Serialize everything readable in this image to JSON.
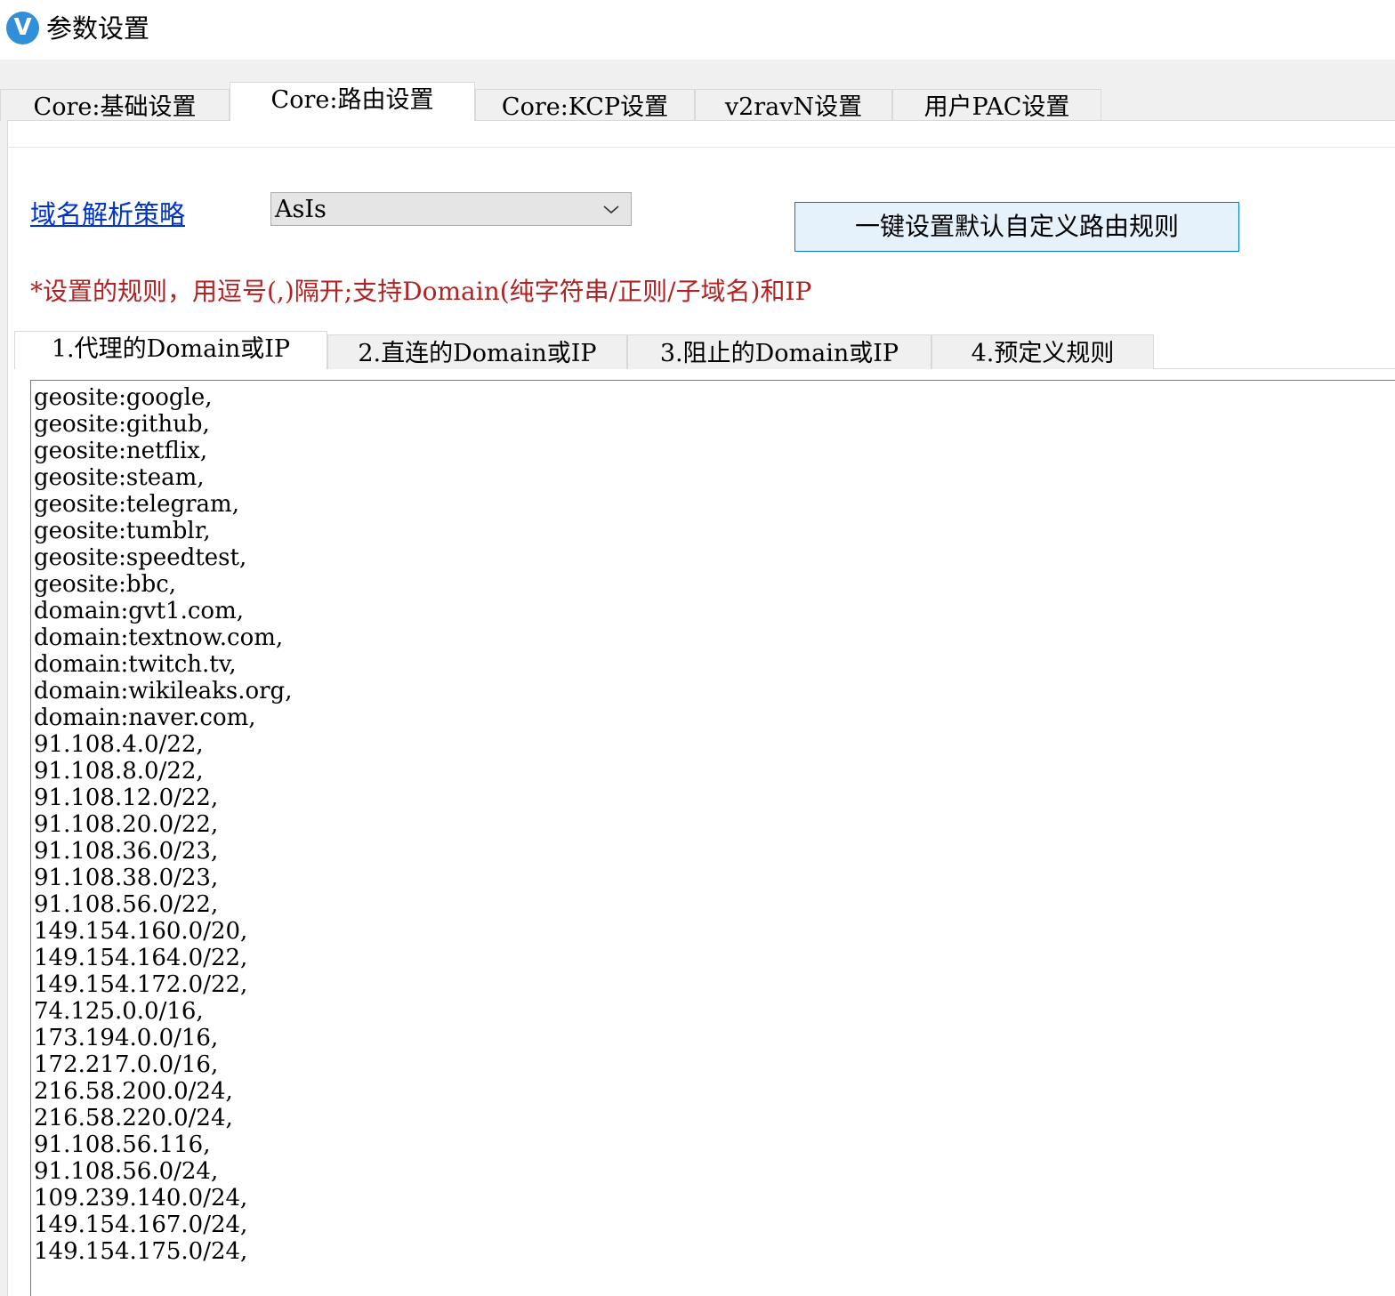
{
  "window": {
    "icon_letter": "V",
    "title": "参数设置"
  },
  "top_tabs": [
    {
      "label": "Core:基础设置",
      "selected": false
    },
    {
      "label": "Core:路由设置",
      "selected": true
    },
    {
      "label": "Core:KCP设置",
      "selected": false
    },
    {
      "label": "v2ravN设置",
      "selected": false
    },
    {
      "label": "用户PAC设置",
      "selected": false
    }
  ],
  "routing": {
    "domain_strategy_label": "域名解析策略",
    "domain_strategy_value": "AsIs",
    "default_rules_button": "一键设置默认自定义路由规则",
    "hint": "*设置的规则，用逗号(,)隔开;支持Domain(纯字符串/正则/子域名)和IP"
  },
  "rule_tabs": [
    {
      "label": "1.代理的Domain或IP",
      "selected": true
    },
    {
      "label": "2.直连的Domain或IP",
      "selected": false
    },
    {
      "label": "3.阻止的Domain或IP",
      "selected": false
    },
    {
      "label": "4.预定义规则",
      "selected": false
    }
  ],
  "proxy_rules": [
    "geosite:google,",
    "geosite:github,",
    "geosite:netflix,",
    "geosite:steam,",
    "geosite:telegram,",
    "geosite:tumblr,",
    "geosite:speedtest,",
    "geosite:bbc,",
    "domain:gvt1.com,",
    "domain:textnow.com,",
    "domain:twitch.tv,",
    "domain:wikileaks.org,",
    "domain:naver.com,",
    "91.108.4.0/22,",
    "91.108.8.0/22,",
    "91.108.12.0/22,",
    "91.108.20.0/22,",
    "91.108.36.0/23,",
    "91.108.38.0/23,",
    "91.108.56.0/22,",
    "149.154.160.0/20,",
    "149.154.164.0/22,",
    "149.154.172.0/22,",
    "74.125.0.0/16,",
    "173.194.0.0/16,",
    "172.217.0.0/16,",
    "216.58.200.0/24,",
    "216.58.220.0/24,",
    "91.108.56.116,",
    "91.108.56.0/24,",
    "109.239.140.0/24,",
    "149.154.167.0/24,",
    "149.154.175.0/24,"
  ]
}
